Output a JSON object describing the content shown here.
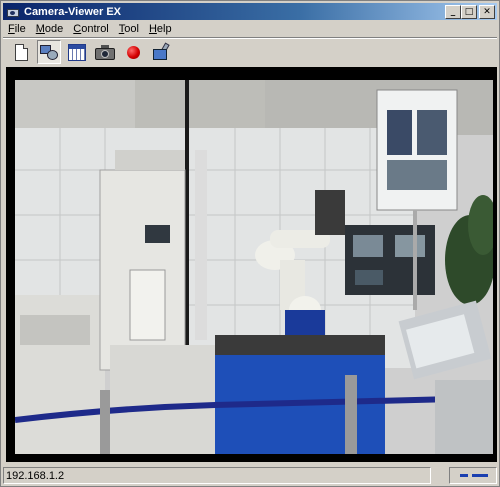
{
  "window": {
    "title": "Camera-Viewer EX"
  },
  "window_buttons": {
    "minimize": "_",
    "maximize": "□",
    "close": "✕"
  },
  "menu": [
    {
      "pre": "",
      "acc": "F",
      "post": "ile"
    },
    {
      "pre": "",
      "acc": "M",
      "post": "ode"
    },
    {
      "pre": "",
      "acc": "C",
      "post": "ontrol"
    },
    {
      "pre": "",
      "acc": "T",
      "post": "ool"
    },
    {
      "pre": "",
      "acc": "H",
      "post": "elp"
    }
  ],
  "toolbar": {
    "icons": [
      "new-document-icon",
      "camera-settings-icon",
      "grid-view-icon",
      "snapshot-camera-icon",
      "record-icon",
      "tools-icon"
    ],
    "pressed": "camera-settings-icon"
  },
  "status": {
    "address": "192.168.1.2"
  },
  "colors": {
    "title_bar_start": "#0a246a",
    "title_bar_end": "#a6caf0",
    "record": "#d40000",
    "signal": "#1a3fb0"
  }
}
